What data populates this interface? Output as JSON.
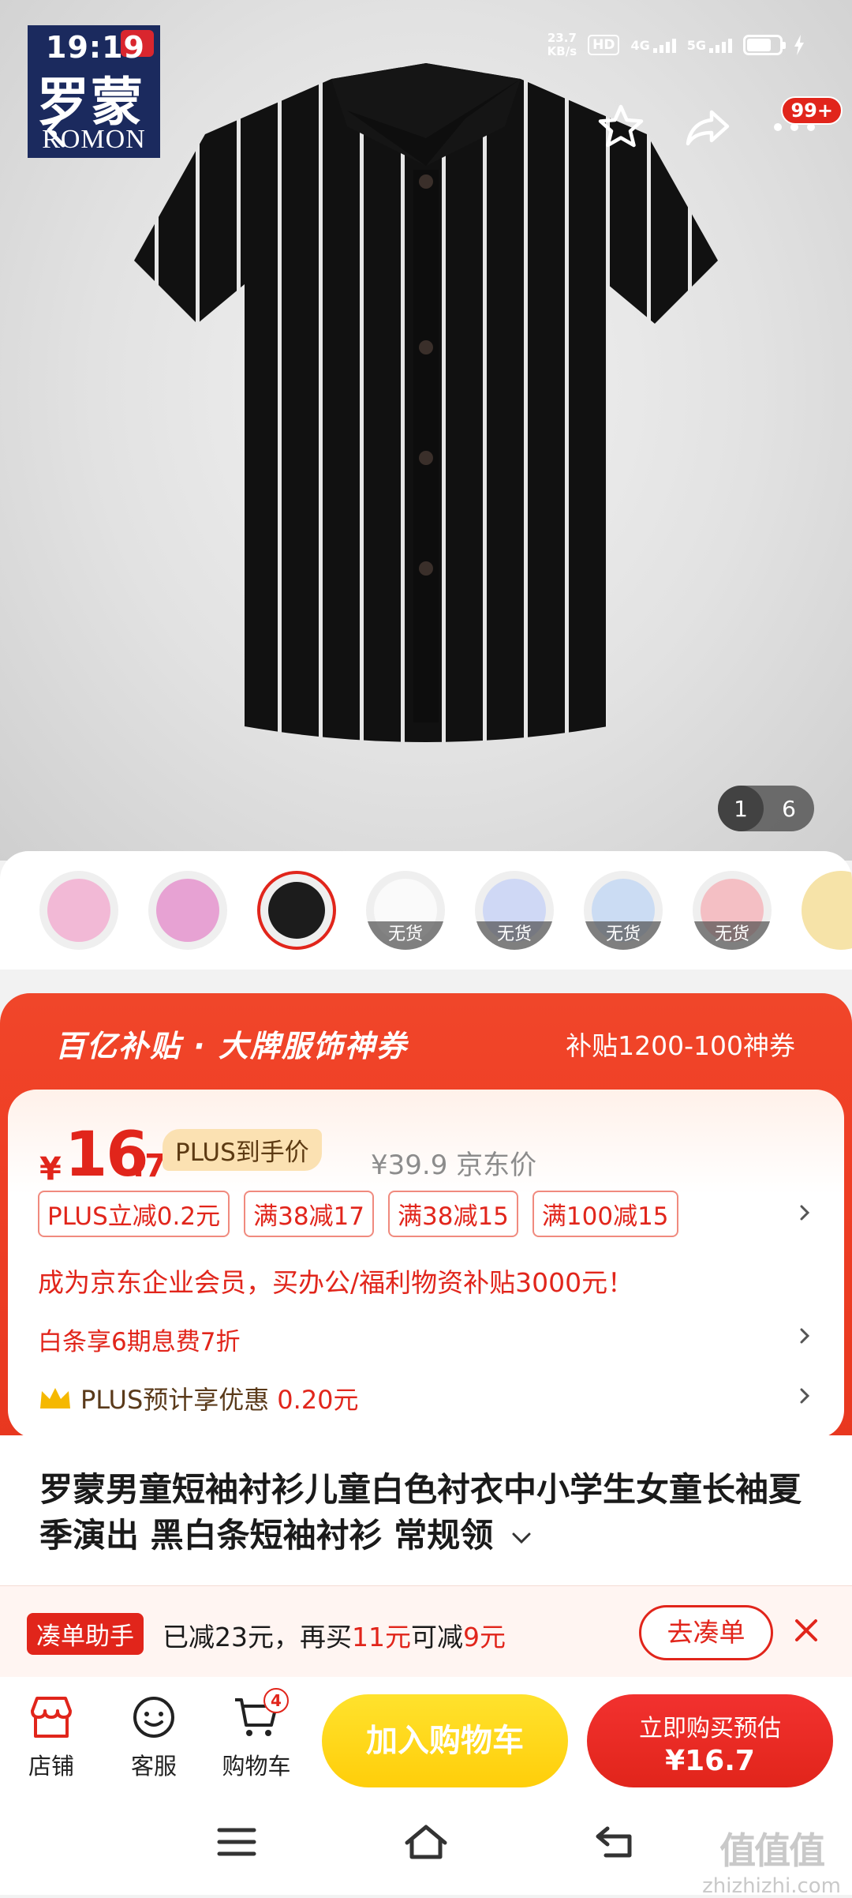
{
  "status_bar": {
    "time": "19:19",
    "net_speed_value": "23.7",
    "net_speed_unit": "KB/s",
    "hd_label": "HD",
    "net_4g": "4G",
    "net_5g": "5G"
  },
  "brand_logo": {
    "cn": "罗蒙",
    "en": "ROMON"
  },
  "header": {
    "more_badge": "99+"
  },
  "gallery": {
    "current": "1",
    "total": "6"
  },
  "variants": [
    {
      "color": "#f2b9d6",
      "stock": ""
    },
    {
      "color": "#e7a2d3",
      "stock": ""
    },
    {
      "color": "#1c1c1c",
      "stock": "",
      "selected": true
    },
    {
      "color": "#fafafa",
      "stock": "无货"
    },
    {
      "color": "#cfd8f5",
      "stock": "无货"
    },
    {
      "color": "#cbdcf3",
      "stock": "无货"
    },
    {
      "color": "#f4bfc4",
      "stock": "无货"
    }
  ],
  "promo": {
    "banner_title": "百亿补贴 · 大牌服饰神券",
    "banner_sub": "补贴1200-100神券",
    "price_symbol": "¥",
    "price_int": "16",
    "price_dec": ".7",
    "plus_label": "PLUS到手价",
    "orig_price": "¥39.9 京东价",
    "coupons": [
      "PLUS立减0.2元",
      "满38减17",
      "满38减15",
      "满100减15"
    ],
    "biz_text": "成为京东企业会员，买办公/福利物资补贴3000元！",
    "baitiao_text": "白条享6期息费7折",
    "plus_prefix": "PLUS预计享优惠",
    "plus_amount": "0.20元"
  },
  "product": {
    "title": "罗蒙男童短袖衬衫儿童白色衬衣中小学生女童长袖夏季演出 黑白条短袖衬衫  常规领"
  },
  "assist": {
    "tag": "凑单助手",
    "text_a": "已减23元，再买",
    "text_b": "11元",
    "text_c": "可减",
    "text_d": "9元",
    "button": "去凑单"
  },
  "bottom_bar": {
    "store": "店铺",
    "service": "客服",
    "cart": "购物车",
    "cart_count": "4",
    "add_cart": "加入购物车",
    "buy_line1": "立即购买预估",
    "buy_line2": "¥16.7"
  },
  "watermark": {
    "big": "值值值",
    "small": "zhizhizhi.com"
  },
  "colors": {
    "accent": "#e1251b",
    "yellow": "#ffd21a",
    "brand_navy": "#1b2a5e"
  }
}
